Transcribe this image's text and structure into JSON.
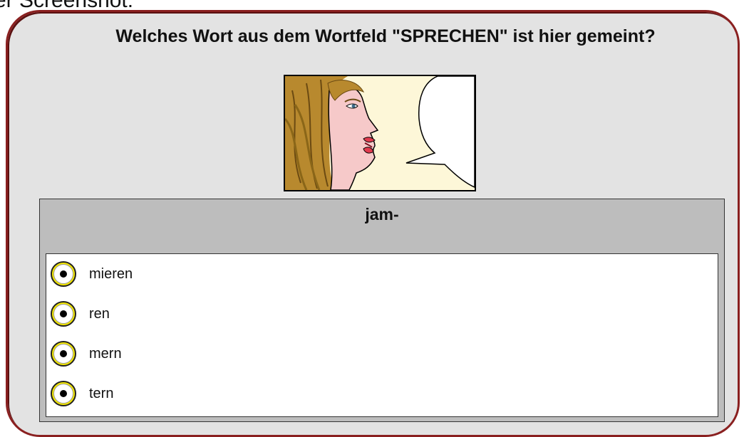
{
  "header_fragment": "er Screenshot:",
  "question": "Welches Wort aus dem Wortfeld \"SPRECHEN\" ist hier gemeint?",
  "stem": "jam-",
  "options": [
    {
      "label": "mieren"
    },
    {
      "label": "ren"
    },
    {
      "label": "mern"
    },
    {
      "label": "tern"
    }
  ],
  "colors": {
    "border": "#8a2020",
    "card": "#e3e3e3",
    "panel": "#bdbdbd",
    "radio": "#f4e800"
  },
  "icons": [
    "woman-speaking-illustration",
    "speech-bubble-icon",
    "radio-button-icon"
  ]
}
